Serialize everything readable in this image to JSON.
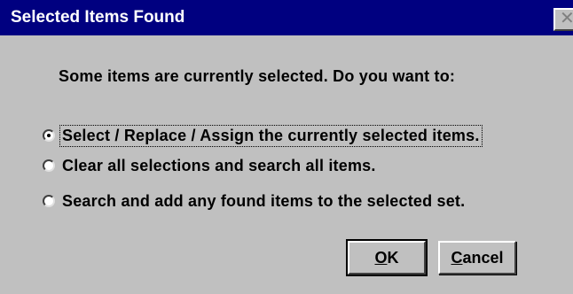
{
  "window": {
    "title": "Selected Items Found",
    "close_glyph": "✕"
  },
  "prompt": "Some items are currently selected.  Do you want to:",
  "options": [
    {
      "label": "Select / Replace / Assign the currently selected items.",
      "selected": true
    },
    {
      "label": "Clear all selections and search all items.",
      "selected": false
    },
    {
      "label": "Search and add any found items to the selected set.",
      "selected": false
    }
  ],
  "buttons": {
    "ok_accel": "O",
    "ok_rest": "K",
    "cancel_accel": "C",
    "cancel_rest": "ancel"
  },
  "colors": {
    "titlebar": "#000080",
    "face": "#c0c0c0"
  },
  "icons": {
    "close": "close-icon",
    "radio": "radio-button-icon"
  }
}
